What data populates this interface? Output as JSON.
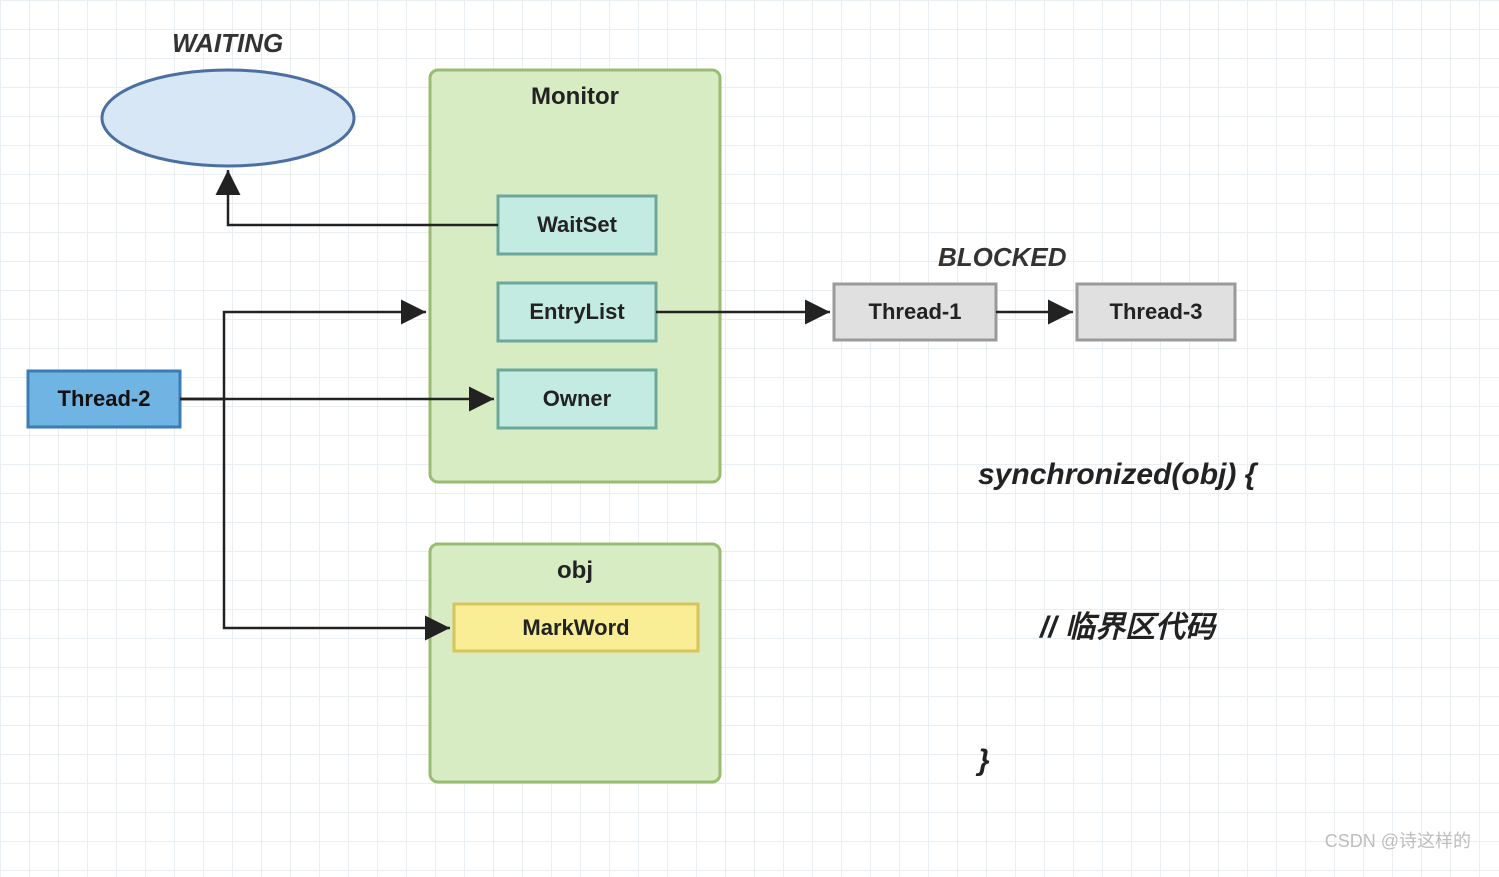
{
  "labels": {
    "waiting": "WAITING",
    "blocked": "BLOCKED"
  },
  "monitor": {
    "title": "Monitor",
    "waitset": "WaitSet",
    "entrylist": "EntryList",
    "owner": "Owner"
  },
  "obj": {
    "title": "obj",
    "markword": "MarkWord"
  },
  "threads": {
    "t2": "Thread-2",
    "t1": "Thread-1",
    "t3": "Thread-3"
  },
  "code": {
    "line1": "synchronized(obj) {",
    "line2": "// 临界区代码",
    "line3": "}"
  },
  "watermark": "CSDN @诗这样的",
  "colors": {
    "monitor_fill": "#d8ecc3",
    "monitor_stroke": "#9abb72",
    "slot_fill": "#c3ebe1",
    "slot_stroke": "#6ca79b",
    "thread2_fill": "#6fb4e3",
    "thread2_stroke": "#3a7db5",
    "blocked_fill": "#e0e0e0",
    "blocked_stroke": "#9a9a9a",
    "markword_fill": "#f9ee95",
    "markword_stroke": "#d8c45b",
    "ellipse_fill": "#d7e7f6",
    "ellipse_stroke": "#4a6fa0"
  }
}
